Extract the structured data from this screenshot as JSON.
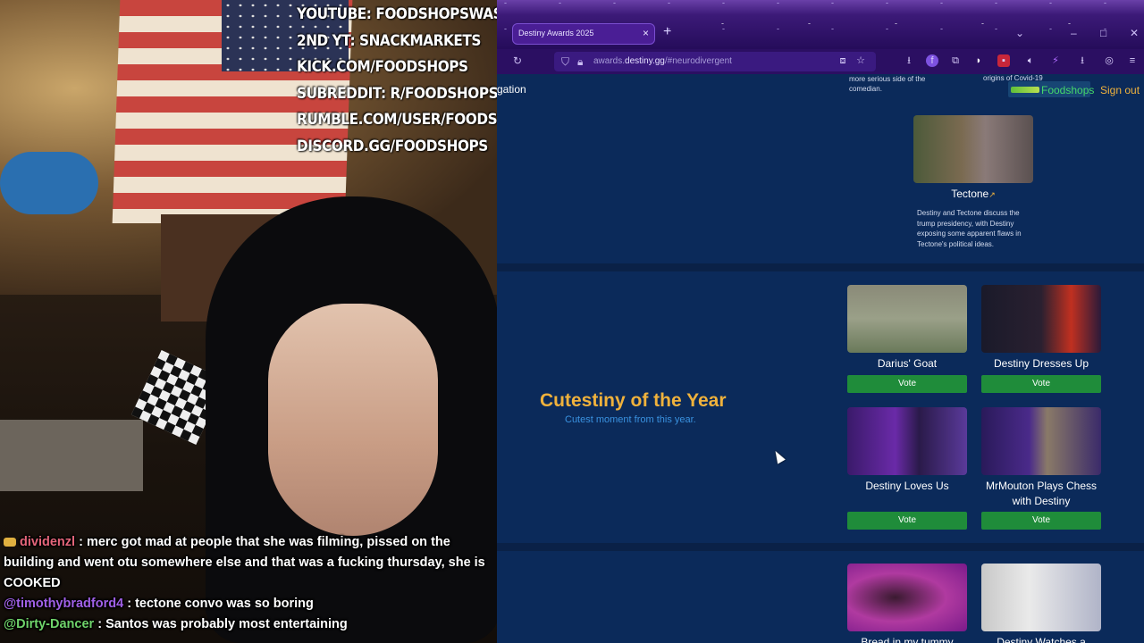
{
  "overlay": {
    "links": [
      "YOUTUBE: FOODSHOPSWASTAKEN",
      "2ND YT: SNACKMARKETS",
      "KICK.COM/FOODSHOPS",
      "SUBREDDIT: R/FOODSHOPS",
      "RUMBLE.COM/USER/FOODSHOPS",
      "DISCORD.GG/FOODSHOPS"
    ]
  },
  "chat": [
    {
      "user": "dividenzl",
      "sep": " : ",
      "text": "merc got mad at people that she was filming, pissed on the building and went otu somewhere else and that was a fucking thursday, she is COOKED"
    },
    {
      "user": "@timothybradford4",
      "sep": " : ",
      "text": "tectone convo was so boring"
    },
    {
      "user": "@Dirty-Dancer",
      "sep": " : ",
      "text": "Santos was probably most entertaining"
    }
  ],
  "browser": {
    "tab_title": "Destiny Awards 2025",
    "tab_close": "×",
    "new_tab": "+",
    "url_host": "awards.destiny.gg",
    "url_path": "/#neurodivergent",
    "url_prefix": "awards.",
    "url_domain": "destiny.gg",
    "url_hash": "/#neurodivergent"
  },
  "page": {
    "nav_fragment": "gation",
    "prev_desc_1": "more serious side of the comedian.",
    "prev_desc_2": "origins of Covid-19",
    "user_name": "Foodshops",
    "sign_out": "Sign out",
    "prev_card": {
      "title": "Tectone",
      "ext": "↗",
      "desc": "Destiny and Tectone discuss the trump presidency, with Destiny exposing some apparent flaws in Tectone's political ideas."
    },
    "category": {
      "title": "Cutestiny of the Year",
      "subtitle": "Cutest moment from this year."
    },
    "vote_label": "Vote",
    "nominees": [
      {
        "title": "Darius' Goat"
      },
      {
        "title": "Destiny Dresses Up"
      },
      {
        "title": "Destiny Loves Us"
      },
      {
        "title": "MrMouton Plays Chess with Destiny"
      }
    ],
    "next_nominees": [
      {
        "title": "Bread in my tummy"
      },
      {
        "title": "Destiny Watches a Series"
      }
    ]
  },
  "colors": {
    "page_bg": "#0b2a5a",
    "accent_gold": "#f0b23c",
    "vote_green": "#1f8c3a",
    "subtitle_blue": "#3a92e0",
    "browser_purple": "#2b0f62"
  }
}
